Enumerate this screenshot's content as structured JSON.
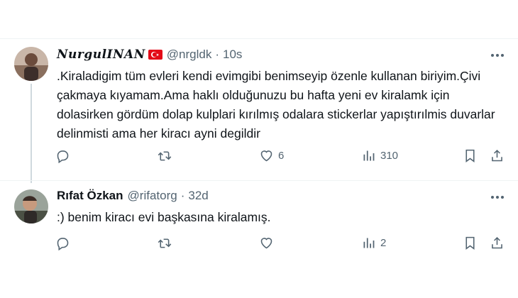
{
  "tweets": [
    {
      "name": "NurgulINAN",
      "handle": "@nrgldk",
      "separator": "·",
      "time": "10s",
      "text": ".Kiraladigim tüm evleri kendi evimgibi benimseyip özenle kullanan biriyim.Çivi çakmaya kıyamam.Ama haklı olduğunuzu bu hafta yeni ev kiralamk için dolasirken gördüm dolap kulplari kırılmış odalara stickerlar yapıştırılmis duvarlar delinmisti ama her kiracı ayni degildir",
      "likes": "6",
      "views": "310"
    },
    {
      "name": "Rıfat Özkan",
      "handle": "@rifatorg",
      "separator": "·",
      "time": "32d",
      "text": ":) benim kiracı evi başkasına kiralamış.",
      "views": "2"
    }
  ],
  "icons": {
    "reply": "reply-icon",
    "retweet": "retweet-icon",
    "like": "heart-icon",
    "views": "views-icon",
    "bookmark": "bookmark-icon",
    "share": "share-icon",
    "more": "more-icon",
    "flag": "turkey-flag-icon"
  },
  "colors": {
    "text": "#0f1419",
    "secondary": "#536471",
    "flag": "#e30a17"
  }
}
